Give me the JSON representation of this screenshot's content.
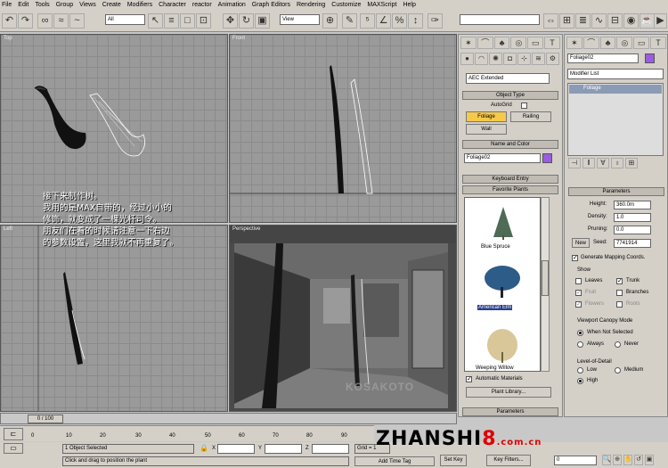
{
  "menu": [
    "File",
    "Edit",
    "Tools",
    "Group",
    "Views",
    "Create",
    "Modifiers",
    "Character",
    "reactor",
    "Animation",
    "Graph Editors",
    "Rendering",
    "Customize",
    "MAXScript",
    "Help"
  ],
  "toolbar": {
    "selection_filter": "All",
    "coord_system": "View",
    "named_selection": ""
  },
  "viewports": {
    "top": "Top",
    "front": "Front",
    "left": "Left",
    "perspective": "Perspective"
  },
  "tutorial_text": [
    "接下来制作树。",
    "我用的是MAX自带的，经过小小的",
    "修饰，就变成了一棵光杆司令。",
    "朋友们在看的时候请注意一下右边",
    "的参数设置，这里我就不再重复了。"
  ],
  "create_panel": {
    "category": "AEC Extended",
    "object_type_header": "Object Type",
    "autogrid": "AutoGrid",
    "buttons": [
      "Foliage",
      "Railing",
      "Wall"
    ],
    "name_color_header": "Name and Color",
    "object_name": "Foliage02",
    "object_color": "#9a5ce0",
    "keyboard_entry_header": "Keyboard Entry",
    "favorite_plants_header": "Favorite Plants",
    "plants": [
      "Blue Spruce",
      "American Elm",
      "Weeping Willow"
    ],
    "automatic_materials": "Automatic Materials",
    "plant_library": "Plant Library...",
    "parameters_header": "Parameters"
  },
  "modify_panel": {
    "object_name": "Foliage02",
    "modifier_list": "Modifier List",
    "stack_item": "Foliage",
    "parameters_header": "Parameters",
    "height_label": "Height:",
    "height": "360.0m",
    "density_label": "Density:",
    "density": "1.0",
    "pruning_label": "Pruning:",
    "pruning": "0.0",
    "new_button": "New",
    "seed_label": "Seed:",
    "seed": "7741914",
    "gen_mapping": "Generate Mapping Coords.",
    "show_label": "Show",
    "show_items": [
      {
        "label": "Leaves",
        "checked": false
      },
      {
        "label": "Trunk",
        "checked": true
      },
      {
        "label": "Fruit",
        "checked": true
      },
      {
        "label": "Branches",
        "checked": false
      },
      {
        "label": "Flowers",
        "checked": true
      },
      {
        "label": "Roots",
        "checked": false
      }
    ],
    "canopy_label": "Viewport Canopy Mode",
    "canopy_options": [
      "When Not Selected",
      "Always",
      "Never"
    ],
    "lod_label": "Level-of-Detail",
    "lod_options": [
      "Low",
      "Medium",
      "High"
    ]
  },
  "timeline": {
    "frame": "0 / 100",
    "ticks": [
      "0",
      "10",
      "20",
      "30",
      "40",
      "50",
      "60",
      "70",
      "80",
      "90",
      "100"
    ]
  },
  "status": {
    "selected": "1 Object Selected",
    "prompt": "Click and drag to position the plant",
    "x_label": "X",
    "y_label": "Y",
    "z_label": "Z",
    "grid": "Grid = 1",
    "add_time_tag": "Add Time Tag",
    "set_key": "Set Key",
    "key_filters": "Key Filters...",
    "frame_field": "0"
  },
  "watermark": {
    "text1": "ZHANSHI",
    "text2": "8",
    "text3": ".com.cn"
  },
  "viewport_watermark": "KOSAKOTO"
}
